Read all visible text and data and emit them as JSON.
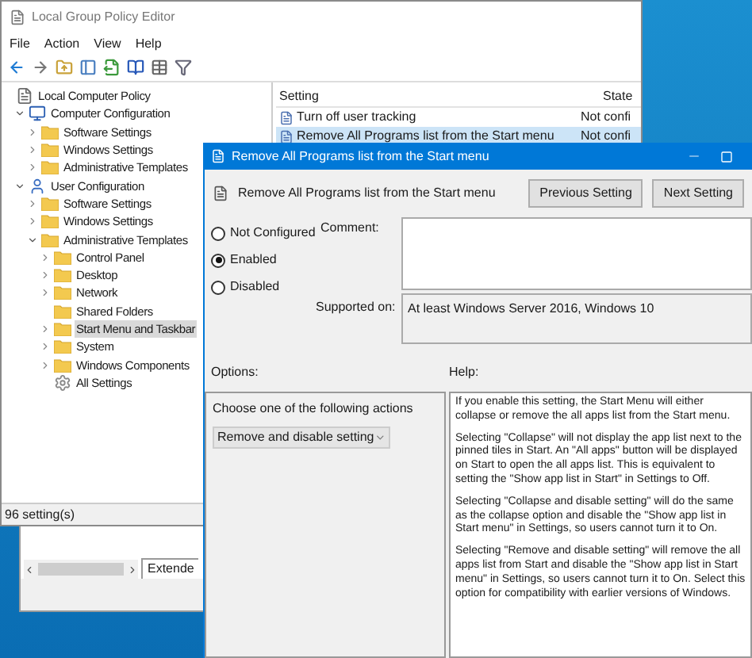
{
  "main_window": {
    "title": "Local Group Policy Editor",
    "menu": [
      "File",
      "Action",
      "View",
      "Help"
    ],
    "tree": [
      {
        "label": "Local Computer Policy",
        "kind": "policy",
        "selected": false,
        "children": [
          {
            "label": "Computer Configuration",
            "kind": "computer",
            "expanded": true,
            "selected": false,
            "children": [
              {
                "label": "Software Settings",
                "kind": "folder",
                "expanded": false,
                "selected": false
              },
              {
                "label": "Windows Settings",
                "kind": "folder",
                "expanded": false,
                "selected": false
              },
              {
                "label": "Administrative Templates",
                "kind": "folder",
                "expanded": false,
                "selected": false
              }
            ]
          },
          {
            "label": "User Configuration",
            "kind": "user",
            "expanded": true,
            "selected": false,
            "children": [
              {
                "label": "Software Settings",
                "kind": "folder",
                "expanded": false,
                "selected": false
              },
              {
                "label": "Windows Settings",
                "kind": "folder",
                "expanded": false,
                "selected": false
              },
              {
                "label": "Administrative Templates",
                "kind": "folder",
                "expanded": true,
                "selected": false,
                "children": [
                  {
                    "label": "Control Panel",
                    "kind": "folder",
                    "expanded": false,
                    "selected": false
                  },
                  {
                    "label": "Desktop",
                    "kind": "folder",
                    "expanded": false,
                    "selected": false
                  },
                  {
                    "label": "Network",
                    "kind": "folder",
                    "expanded": false,
                    "selected": false
                  },
                  {
                    "label": "Shared Folders",
                    "kind": "folder",
                    "selected": false
                  },
                  {
                    "label": "Start Menu and Taskbar",
                    "kind": "folder",
                    "expanded": false,
                    "selected": true
                  },
                  {
                    "label": "System",
                    "kind": "folder",
                    "expanded": false,
                    "selected": false
                  },
                  {
                    "label": "Windows Components",
                    "kind": "folder",
                    "expanded": false,
                    "selected": false
                  },
                  {
                    "label": "All Settings",
                    "kind": "all",
                    "selected": false
                  }
                ]
              }
            ]
          }
        ]
      }
    ],
    "list": {
      "columns": [
        "Setting",
        "State"
      ],
      "rows": [
        {
          "setting": "Turn off user tracking",
          "state": "Not confi",
          "selected": false
        },
        {
          "setting": "Remove All Programs list from the Start menu",
          "state": "Not confi",
          "selected": true
        }
      ]
    },
    "status_bar": "96 setting(s)"
  },
  "background_window": {
    "tab": "Extende"
  },
  "dialog": {
    "title": "Remove All Programs list from the Start menu",
    "setting_name": "Remove All Programs list from the Start menu",
    "buttons": [
      "Previous Setting",
      "Next Setting"
    ],
    "radios": [
      {
        "label": "Not Configured",
        "selected": false
      },
      {
        "label": "Enabled",
        "selected": true
      },
      {
        "label": "Disabled",
        "selected": false
      }
    ],
    "comment_label": "Comment:",
    "supported_label": "Supported on:",
    "supported_value": "At least Windows Server 2016, Windows 10",
    "options_label": "Options:",
    "help_label": "Help:",
    "options_prompt": "Choose one of the following actions",
    "dropdown_value": "Remove and disable setting",
    "help_paragraphs": [
      "If you enable this setting, the Start Menu will either collapse or remove the all apps list from the Start menu.",
      "Selecting \"Collapse\" will not display the app list next to the pinned tiles in Start. An \"All apps\" button will be displayed on Start to open the all apps list. This is equivalent to setting the \"Show app list in Start\" in Settings to Off.",
      "Selecting \"Collapse and disable setting\" will do the same as the collapse option and disable the \"Show app list in Start menu\" in Settings, so users cannot turn it to On.",
      "Selecting \"Remove and disable setting\" will remove the all apps list from Start and disable the \"Show app list in Start menu\" in Settings, so users cannot turn it to On. Select this option for compatibility with earlier versions of Windows."
    ]
  }
}
